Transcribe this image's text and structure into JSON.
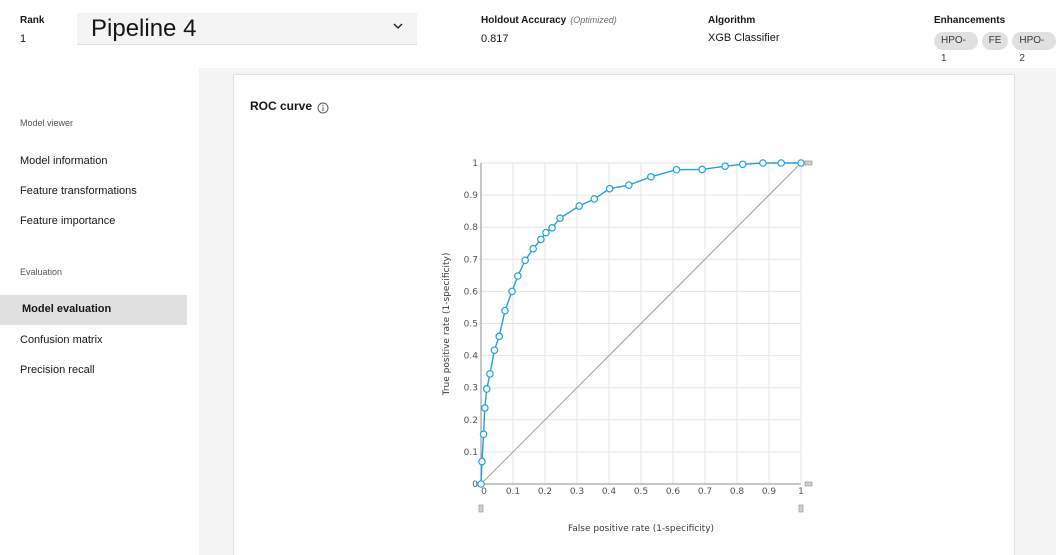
{
  "header": {
    "rank_label": "Rank",
    "rank_value": "1",
    "pipeline_name": "Pipeline 4",
    "accuracy_label": "Holdout Accuracy",
    "accuracy_note": "(Optimized)",
    "accuracy_value": "0.817",
    "algorithm_label": "Algorithm",
    "algorithm_value": "XGB Classifier",
    "enhancements_label": "Enhancements",
    "enhancements": [
      "HPO-1",
      "FE",
      "HPO-2"
    ]
  },
  "sidebar": {
    "section_viewer": "Model viewer",
    "viewer_items": [
      "Model information",
      "Feature transformations",
      "Feature importance"
    ],
    "section_evaluation": "Evaluation",
    "active_item": "Model evaluation",
    "evaluation_items": [
      "Confusion matrix",
      "Precision recall"
    ]
  },
  "card": {
    "title": "ROC curve"
  },
  "icons": {
    "dropdown": "chevron-down-icon",
    "info": "info-icon"
  },
  "colors": {
    "series": "#1ea1dc",
    "diagonal": "#9e9e9e",
    "active_nav": "#e0e0e0"
  },
  "chart_data": {
    "type": "line",
    "title": "",
    "xlabel": "False positive rate (1-specificity)",
    "ylabel": "True positive rate (1-specificity)",
    "xlim": [
      0,
      1
    ],
    "ylim": [
      0,
      1
    ],
    "xticks": [
      "0",
      "0.1",
      "0.2",
      "0.3",
      "0.4",
      "0.5",
      "0.6",
      "0.7",
      "0.8",
      "0.9",
      "1"
    ],
    "yticks": [
      "0",
      "0.1",
      "0.2",
      "0.3",
      "0.4",
      "0.5",
      "0.6",
      "0.7",
      "0.8",
      "0.9",
      "1"
    ],
    "grid": true,
    "series": [
      {
        "x": [
          0,
          0.003,
          0.008,
          0.012,
          0.018,
          0.028,
          0.042,
          0.057,
          0.075,
          0.097,
          0.115,
          0.138,
          0.163,
          0.187,
          0.203,
          0.222,
          0.247,
          0.307,
          0.354,
          0.402,
          0.462,
          0.531,
          0.611,
          0.691,
          0.763,
          0.818,
          0.881,
          0.938,
          1.0
        ],
        "y": [
          0,
          0.07,
          0.155,
          0.237,
          0.296,
          0.343,
          0.417,
          0.46,
          0.54,
          0.6,
          0.648,
          0.697,
          0.733,
          0.762,
          0.783,
          0.798,
          0.828,
          0.866,
          0.888,
          0.92,
          0.931,
          0.957,
          0.979,
          0.98,
          0.99,
          0.996,
          1.0,
          1.0,
          1.0
        ]
      }
    ],
    "baseline": {
      "x": [
        0,
        1
      ],
      "y": [
        0,
        1
      ]
    }
  }
}
